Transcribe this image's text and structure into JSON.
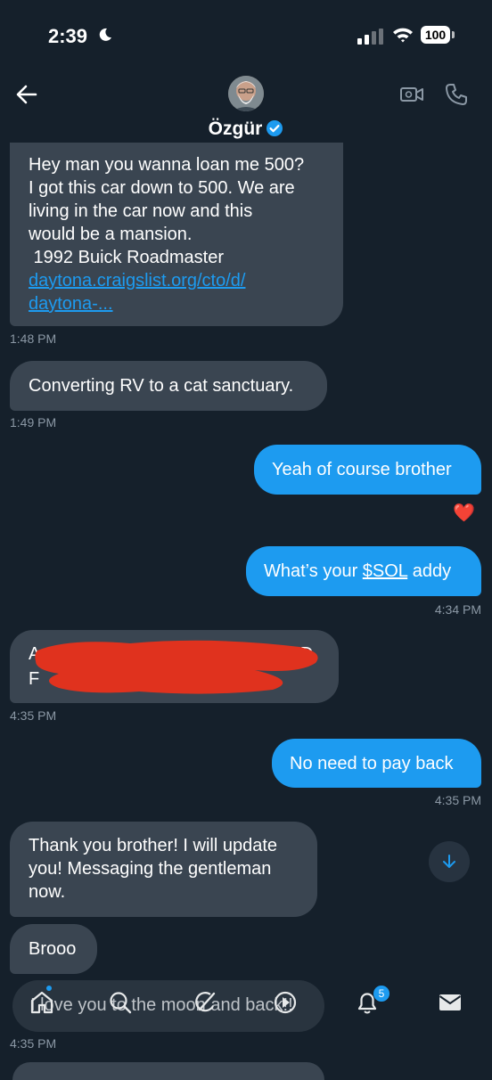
{
  "status_bar": {
    "time": "2:39",
    "battery": "100"
  },
  "header": {
    "name": "Özgür",
    "verified": true
  },
  "messages": [
    {
      "lines": [
        "Hey man you wanna loan me 500?",
        "I got this car down to 500. We are",
        "living in the car now and this",
        "would be a mansion.",
        " 1992 Buick Roadmaster"
      ],
      "link_lines": [
        "daytona.craigslist.org/cto/d/",
        "daytona-..."
      ],
      "time": "1:48 PM"
    },
    {
      "text": "Converting RV to a cat sanctuary.",
      "time": "1:49 PM"
    },
    {
      "text": "Yeah of course brother",
      "reaction": "❤️"
    },
    {
      "prefix": "What’s your ",
      "cashtag": "$SOL",
      "suffix": " addy",
      "time": "4:34 PM"
    },
    {
      "partial_1": "A",
      "partial_2": "F",
      "partial_3": "INNDE'A TD",
      "time": "4:35 PM"
    },
    {
      "text": "No need to pay back",
      "time": "4:35 PM"
    },
    {
      "lines": [
        "Thank you brother! I will update",
        "you! Messaging the gentleman",
        "now."
      ]
    },
    {
      "text": "Brooo"
    },
    {
      "text": "I love you to the moon and back!!",
      "time": "4:35 PM"
    }
  ],
  "tabbar": {
    "notification_count": "5"
  },
  "colors": {
    "background": "#15202b",
    "incoming": "#3a4551",
    "outgoing": "#1d9bf0",
    "redaction": "#e0321e"
  },
  "icons": [
    "back-arrow-icon",
    "video-call-icon",
    "phone-icon",
    "verified-badge-icon",
    "home-icon",
    "search-icon",
    "grok-icon",
    "communities-icon",
    "bell-icon",
    "mail-icon",
    "chevron-down-icon"
  ]
}
